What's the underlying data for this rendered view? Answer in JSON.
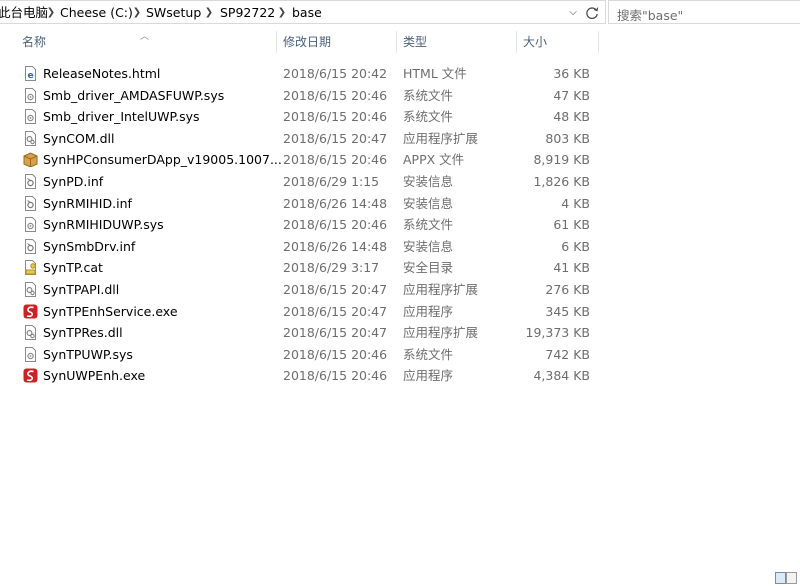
{
  "address": {
    "crumbs": [
      "此台电脑",
      "Cheese (C:)",
      "SWsetup",
      "SP92722",
      "base"
    ]
  },
  "search": {
    "placeholder": "搜索\"base\""
  },
  "columns": {
    "name": "名称",
    "date": "修改日期",
    "type": "类型",
    "size": "大小"
  },
  "files": [
    {
      "name": "ReleaseNotes.html",
      "date": "2018/6/15 20:42",
      "type": "HTML 文件",
      "size": "36 KB",
      "icon": "html-file-icon"
    },
    {
      "name": "Smb_driver_AMDASFUWP.sys",
      "date": "2018/6/15 20:46",
      "type": "系统文件",
      "size": "47 KB",
      "icon": "system-file-icon"
    },
    {
      "name": "Smb_driver_IntelUWP.sys",
      "date": "2018/6/15 20:46",
      "type": "系统文件",
      "size": "48 KB",
      "icon": "system-file-icon"
    },
    {
      "name": "SynCOM.dll",
      "date": "2018/6/15 20:47",
      "type": "应用程序扩展",
      "size": "803 KB",
      "icon": "dll-file-icon"
    },
    {
      "name": "SynHPConsumerDApp_v19005.1007...",
      "date": "2018/6/15 20:46",
      "type": "APPX 文件",
      "size": "8,919 KB",
      "icon": "package-icon"
    },
    {
      "name": "SynPD.inf",
      "date": "2018/6/29 1:15",
      "type": "安装信息",
      "size": "1,826 KB",
      "icon": "inf-file-icon"
    },
    {
      "name": "SynRMIHID.inf",
      "date": "2018/6/26 14:48",
      "type": "安装信息",
      "size": "4 KB",
      "icon": "inf-file-icon"
    },
    {
      "name": "SynRMIHIDUWP.sys",
      "date": "2018/6/15 20:46",
      "type": "系统文件",
      "size": "61 KB",
      "icon": "system-file-icon"
    },
    {
      "name": "SynSmbDrv.inf",
      "date": "2018/6/26 14:48",
      "type": "安装信息",
      "size": "6 KB",
      "icon": "inf-file-icon"
    },
    {
      "name": "SynTP.cat",
      "date": "2018/6/29 3:17",
      "type": "安全目录",
      "size": "41 KB",
      "icon": "catalog-file-icon"
    },
    {
      "name": "SynTPAPI.dll",
      "date": "2018/6/15 20:47",
      "type": "应用程序扩展",
      "size": "276 KB",
      "icon": "dll-file-icon"
    },
    {
      "name": "SynTPEnhService.exe",
      "date": "2018/6/15 20:47",
      "type": "应用程序",
      "size": "345 KB",
      "icon": "synaptics-exe-icon"
    },
    {
      "name": "SynTPRes.dll",
      "date": "2018/6/15 20:47",
      "type": "应用程序扩展",
      "size": "19,373 KB",
      "icon": "dll-file-icon"
    },
    {
      "name": "SynTPUWP.sys",
      "date": "2018/6/15 20:46",
      "type": "系统文件",
      "size": "742 KB",
      "icon": "system-file-icon"
    },
    {
      "name": "SynUWPEnh.exe",
      "date": "2018/6/15 20:46",
      "type": "应用程序",
      "size": "4,384 KB",
      "icon": "synaptics-exe-icon"
    }
  ]
}
